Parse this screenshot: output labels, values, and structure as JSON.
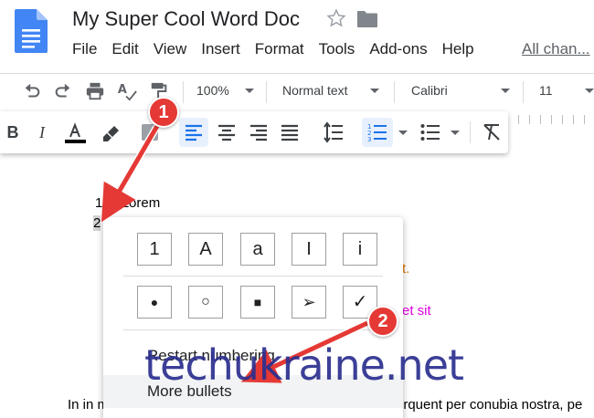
{
  "header": {
    "title": "My Super Cool Word Doc",
    "menu": [
      "File",
      "Edit",
      "View",
      "Insert",
      "Format",
      "Tools",
      "Add-ons",
      "Help"
    ],
    "changes_link": "All chan..."
  },
  "toolbar": {
    "zoom": "100%",
    "style": "Normal text",
    "font": "Calibri",
    "font_size": "11"
  },
  "document": {
    "list_item_1_number": "1.",
    "list_item_1_text": "Lorem",
    "list_item_2_number": "2",
    "partial_orange": "t.",
    "partial_magenta": "et sit",
    "bottom_left": "In in m",
    "bottom_right": "orquent per conubia nostra, pe",
    "orange_color": "#e37400",
    "magenta_color": "#e100e1"
  },
  "bullet_menu": {
    "numbered_glyphs": [
      "1",
      "A",
      "a",
      "I",
      "i"
    ],
    "bullet_glyphs": [
      "●",
      "○",
      "■",
      "➢",
      "✓"
    ],
    "restart_numbering": "Restart numbering",
    "more_bullets": "More bullets"
  },
  "annotations": {
    "callout_1": "1",
    "callout_2": "2",
    "arrow_color": "#e53935"
  },
  "watermark": "techukraine.net"
}
